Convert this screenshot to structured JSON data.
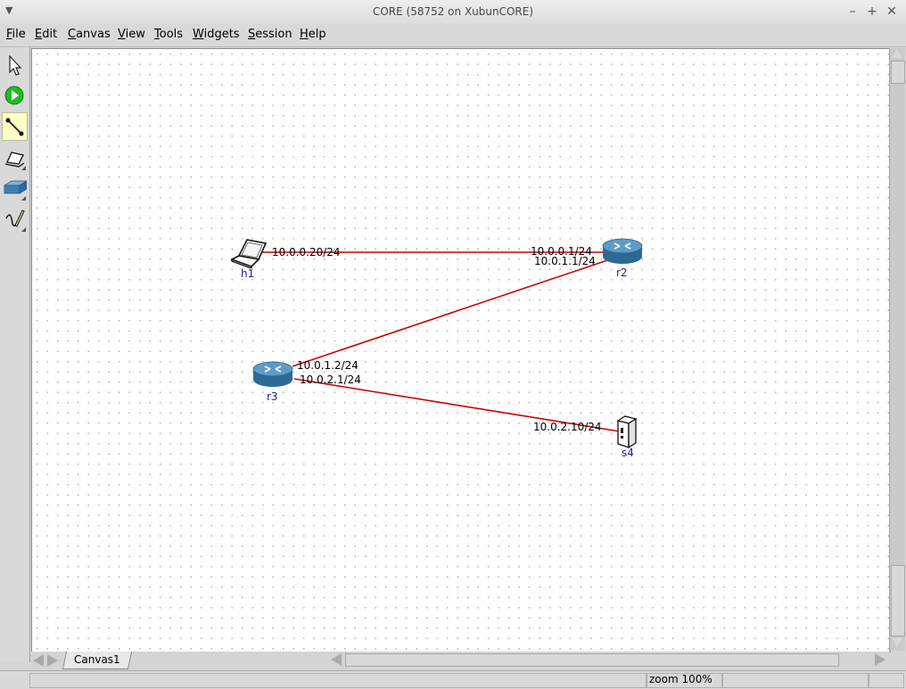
{
  "window": {
    "title": "CORE (58752 on XubunCORE)"
  },
  "menu": [
    {
      "u": "F",
      "rest": "ile"
    },
    {
      "u": "E",
      "rest": "dit"
    },
    {
      "u": "C",
      "rest": "anvas"
    },
    {
      "u": "V",
      "rest": "iew"
    },
    {
      "u": "T",
      "rest": "ools"
    },
    {
      "u": "W",
      "rest": "idgets"
    },
    {
      "u": "S",
      "rest": "ession"
    },
    {
      "u": "H",
      "rest": "elp"
    }
  ],
  "toolbar": {
    "tools": [
      "select-tool-icon",
      "start-session-icon",
      "link-tool-icon",
      "network-node-icon",
      "link-layer-node-icon",
      "annotation-tool-icon"
    ],
    "active_tool": "link-tool-icon"
  },
  "topology": {
    "nodes": [
      {
        "name": "h1",
        "type": "host-laptop"
      },
      {
        "name": "r2",
        "type": "router"
      },
      {
        "name": "r3",
        "type": "router"
      },
      {
        "name": "s4",
        "type": "server"
      }
    ],
    "links": [
      {
        "from": "h1",
        "to": "r2",
        "from_ip": "10.0.0.20/24",
        "to_ip": "10.0.0.1/24"
      },
      {
        "from": "r2",
        "to": "r3",
        "from_ip": "10.0.1.1/24",
        "to_ip": "10.0.1.2/24"
      },
      {
        "from": "r3",
        "to": "s4",
        "from_ip": "10.0.2.1/24",
        "to_ip": "10.0.2.10/24"
      }
    ],
    "link_color": "#cc0000"
  },
  "tabs": {
    "active": "Canvas1"
  },
  "status": {
    "zoom": "zoom 100%"
  }
}
